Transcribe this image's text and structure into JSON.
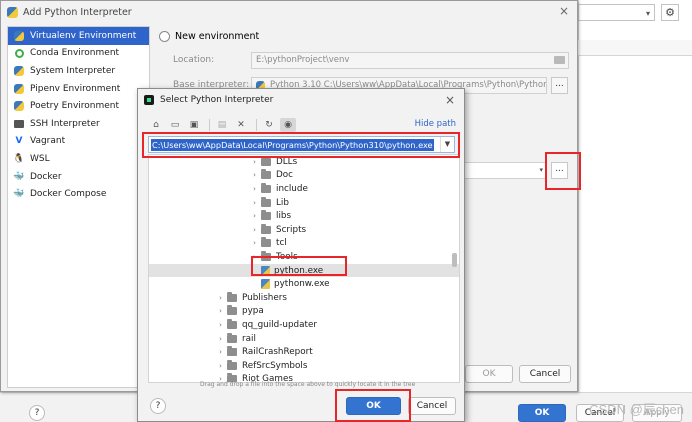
{
  "ide": {
    "combo_arrow": "▾",
    "gear": "⚙"
  },
  "add_dialog": {
    "title": "Add Python Interpreter",
    "close": "×",
    "sidebar": [
      {
        "label": "Virtualenv Environment",
        "icon": "virtualenv-icon",
        "selected": true
      },
      {
        "label": "Conda Environment",
        "icon": "conda-icon",
        "selected": false
      },
      {
        "label": "System Interpreter",
        "icon": "python-icon",
        "selected": false
      },
      {
        "label": "Pipenv Environment",
        "icon": "pipenv-icon",
        "selected": false
      },
      {
        "label": "Poetry Environment",
        "icon": "poetry-icon",
        "selected": false
      },
      {
        "label": "SSH Interpreter",
        "icon": "ssh-icon",
        "selected": false
      },
      {
        "label": "Vagrant",
        "icon": "vagrant-icon",
        "selected": false
      },
      {
        "label": "WSL",
        "icon": "wsl-icon",
        "selected": false
      },
      {
        "label": "Docker",
        "icon": "docker-icon",
        "selected": false
      },
      {
        "label": "Docker Compose",
        "icon": "docker-compose-icon",
        "selected": false
      }
    ],
    "new_env_label": "New environment",
    "location_label": "Location:",
    "location_value": "E:\\pythonProject\\venv",
    "base_label": "Base interpreter:",
    "base_value": "Python 3.10 C:\\Users\\ww\\AppData\\Local\\Programs\\Python\\Python310\\pyth",
    "ok": "OK",
    "cancel": "Cancel",
    "dots": "..."
  },
  "select_dialog": {
    "title": "Select Python Interpreter",
    "close": "×",
    "hide_path": "Hide path",
    "path": "C:\\Users\\ww\\AppData\\Local\\Programs\\Python\\Python310\\python.exe",
    "tree": [
      {
        "label": "DLLs",
        "type": "folder",
        "indent": 1,
        "expand": true
      },
      {
        "label": "Doc",
        "type": "folder",
        "indent": 1,
        "expand": true
      },
      {
        "label": "include",
        "type": "folder",
        "indent": 1,
        "expand": true
      },
      {
        "label": "Lib",
        "type": "folder",
        "indent": 1,
        "expand": true
      },
      {
        "label": "libs",
        "type": "folder",
        "indent": 1,
        "expand": true
      },
      {
        "label": "Scripts",
        "type": "folder",
        "indent": 1,
        "expand": true
      },
      {
        "label": "tcl",
        "type": "folder",
        "indent": 1,
        "expand": true
      },
      {
        "label": "Tools",
        "type": "folder",
        "indent": 1,
        "expand": true
      },
      {
        "label": "python.exe",
        "type": "file",
        "indent": 1,
        "expand": false,
        "selected": true
      },
      {
        "label": "pythonw.exe",
        "type": "file",
        "indent": 1,
        "expand": false
      },
      {
        "label": "Publishers",
        "type": "folder",
        "indent": 0,
        "expand": true
      },
      {
        "label": "pypa",
        "type": "folder",
        "indent": 0,
        "expand": true
      },
      {
        "label": "qq_guild-updater",
        "type": "folder",
        "indent": 0,
        "expand": true
      },
      {
        "label": "rail",
        "type": "folder",
        "indent": 0,
        "expand": true
      },
      {
        "label": "RailCrashReport",
        "type": "folder",
        "indent": 0,
        "expand": true
      },
      {
        "label": "RefSrcSymbols",
        "type": "folder",
        "indent": 0,
        "expand": true
      },
      {
        "label": "Riot Games",
        "type": "folder",
        "indent": 0,
        "expand": true
      }
    ],
    "drag_hint": "Drag and drop a file into the space above to quickly locate it in the tree",
    "help": "?",
    "ok": "OK",
    "cancel": "Cancel"
  },
  "bottom": {
    "help": "?",
    "ok": "OK",
    "cancel": "Cancel",
    "apply": "Apply"
  },
  "watermark": "CSDN @辰chen",
  "colors": {
    "accent": "#2f65ca",
    "highlight_red": "#e8262a",
    "primary_button": "#3374d1"
  }
}
